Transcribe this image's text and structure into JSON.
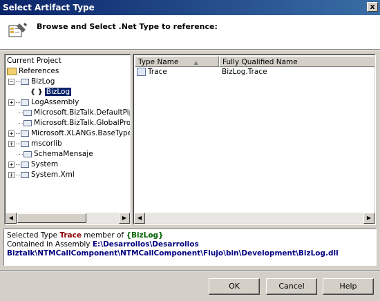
{
  "window": {
    "title": "Select Artifact Type",
    "close_label": "x"
  },
  "header": {
    "instruction": "Browse and Select .Net Type to reference:"
  },
  "tree": {
    "root": "Current Project",
    "references": "References",
    "items": [
      {
        "label": "BizLog",
        "expander": "−"
      },
      {
        "label": "BizLog",
        "icon": "{ }"
      },
      {
        "label": "LogAssembly",
        "expander": "+"
      },
      {
        "label": "Microsoft.BizTalk.DefaultPipelin"
      },
      {
        "label": "Microsoft.BizTalk.GlobalPropert"
      },
      {
        "label": "Microsoft.XLANGs.BaseTypes",
        "expander": "+"
      },
      {
        "label": "mscorlib",
        "expander": "+"
      },
      {
        "label": "SchemaMensaje"
      },
      {
        "label": "System",
        "expander": "+"
      },
      {
        "label": "System.Xml",
        "expander": "+"
      }
    ]
  },
  "list": {
    "columns": [
      "Type Name",
      "Fully Qualified Name"
    ],
    "rows": [
      {
        "name": "Trace",
        "qualified": "BizLog.Trace"
      }
    ]
  },
  "info": {
    "line1_prefix": "Selected Type",
    "type": "Trace",
    "line1_mid": "member of",
    "namespace": "{BizLog}",
    "line2_prefix": "Contained in Assembly",
    "path": "E:\\Desarrollos\\Desarrollos Biztalk\\NTMCallComponent\\NTMCallComponent\\Flujo\\bin\\Development\\BizLog.dll"
  },
  "buttons": {
    "ok": "OK",
    "cancel": "Cancel",
    "help": "Help"
  },
  "colors": {
    "title_bar": "#0a246a",
    "selection": "#0a246a",
    "type_text": "#8b0000",
    "namespace_text": "#006400",
    "path_text": "#000080"
  }
}
